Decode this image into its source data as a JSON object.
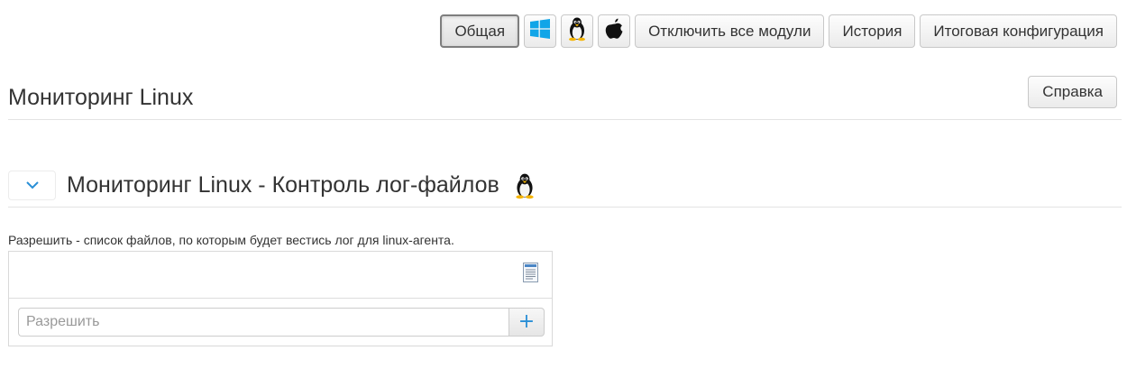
{
  "toolbar": {
    "general_label": "Общая",
    "windows_icon": "windows-icon",
    "linux_icon": "linux-tux-icon",
    "apple_icon": "apple-icon",
    "disable_all_label": "Отключить все модули",
    "history_label": "История",
    "final_config_label": "Итоговая конфигурация"
  },
  "header": {
    "title": "Мониторинг Linux",
    "help_label": "Справка"
  },
  "section": {
    "collapse_icon": "chevron-down-icon",
    "title": "Мониторинг Linux - Контроль лог-файлов",
    "os_icon": "linux-tux-icon"
  },
  "allow_list": {
    "description": "Разрешить - список файлов, по которым будет вестись лог для linux-агента.",
    "list_icon": "document-list-icon",
    "input_value": "",
    "input_placeholder": "Разрешить",
    "add_label": "+"
  },
  "colors": {
    "accent": "#2a8fd6",
    "windows_blue": "#10a5e8",
    "border": "#d9d9d9"
  }
}
